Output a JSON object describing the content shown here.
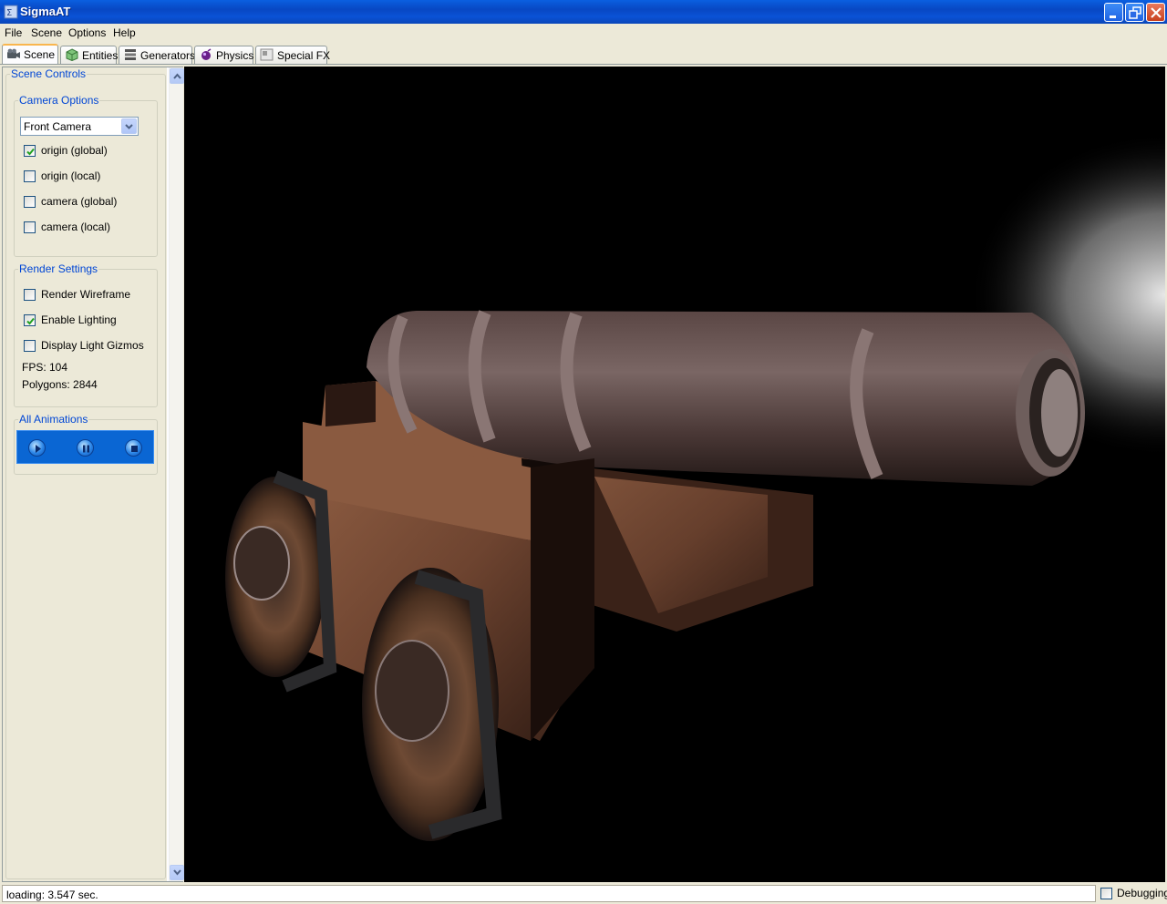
{
  "window": {
    "title": "SigmaAT"
  },
  "menu": {
    "items": [
      "File",
      "Scene",
      "Options",
      "Help"
    ]
  },
  "tabs": [
    {
      "label": "Scene",
      "icon": "camera-icon",
      "active": true
    },
    {
      "label": "Entities",
      "icon": "cube-icon",
      "active": false
    },
    {
      "label": "Generators",
      "icon": "generator-icon",
      "active": false
    },
    {
      "label": "Physics",
      "icon": "physics-icon",
      "active": false
    },
    {
      "label": "Special FX",
      "icon": "fx-icon",
      "active": false
    }
  ],
  "scene_controls": {
    "title": "Scene Controls",
    "camera_options": {
      "title": "Camera Options",
      "camera_select": "Front Camera",
      "checkboxes": [
        {
          "label": "origin (global)",
          "checked": true
        },
        {
          "label": "origin (local)",
          "checked": false
        },
        {
          "label": "camera (global)",
          "checked": false
        },
        {
          "label": "camera (local)",
          "checked": false
        }
      ]
    },
    "render_settings": {
      "title": "Render Settings",
      "checkboxes": [
        {
          "label": "Render Wireframe",
          "checked": false
        },
        {
          "label": "Enable Lighting",
          "checked": true
        },
        {
          "label": "Display Light Gizmos",
          "checked": false
        }
      ],
      "fps": "FPS: 104",
      "polygons": "Polygons: 2844"
    },
    "animations": {
      "title": "All Animations",
      "buttons": [
        "play-icon",
        "pause-icon",
        "stop-icon"
      ]
    }
  },
  "status": {
    "text": "loading: 3.547 sec.",
    "debugging_label": "Debugging",
    "debugging_checked": false
  },
  "colors": {
    "titlebar": "#0a52d6",
    "group_title": "#0046d5",
    "viewport_bg": "#000000",
    "anim_bar": "#0a66d3"
  }
}
